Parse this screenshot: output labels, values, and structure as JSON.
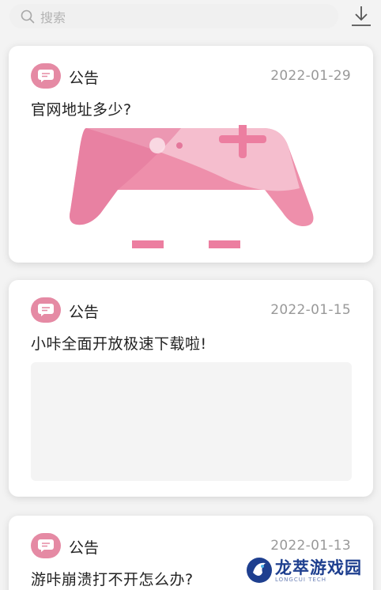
{
  "search": {
    "placeholder": "搜索"
  },
  "colors": {
    "accent": "#e58aa4",
    "date": "#999999",
    "card_bg": "#ffffff",
    "page_bg": "#f3f3f3"
  },
  "announcements": [
    {
      "tag": "公告",
      "date": "2022-01-29",
      "title": "官网地址多少?",
      "image": "gamepad-banner"
    },
    {
      "tag": "公告",
      "date": "2022-01-15",
      "title": "小咔全面开放极速下载啦!",
      "image": "blank-placeholder"
    },
    {
      "tag": "公告",
      "date": "2022-01-13",
      "title": "游咔崩溃打不开怎么办?",
      "image": "none"
    }
  ],
  "watermark": {
    "name": "龙萃游戏园",
    "sub": "LONGCUI TECH"
  }
}
